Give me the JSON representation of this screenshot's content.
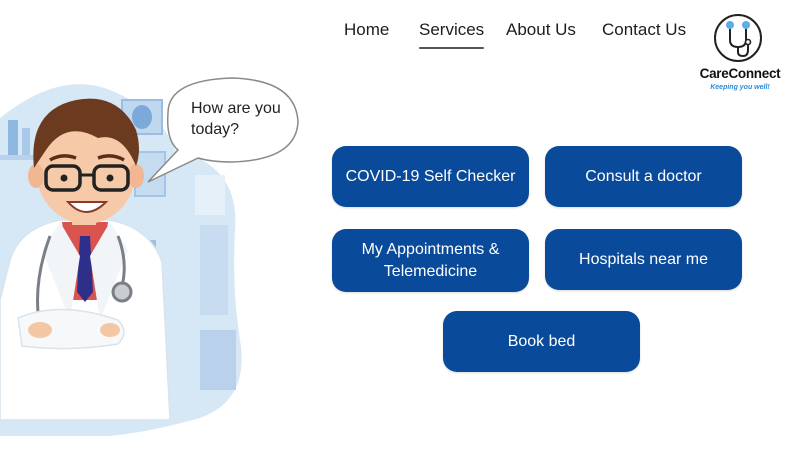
{
  "nav": {
    "items": [
      {
        "label": "Home",
        "active": false
      },
      {
        "label": "Services",
        "active": true
      },
      {
        "label": "About Us",
        "active": false
      },
      {
        "label": "Contact Us",
        "active": false
      }
    ]
  },
  "logo": {
    "name": "CareConnect",
    "tagline": "Keeping you well!",
    "icon": "stethoscope-icon",
    "tagline_color": "#2a8bd8"
  },
  "bubble": {
    "text_line1": "How are you",
    "text_line2": "today?"
  },
  "services": {
    "covid_checker": "COVID-19 Self Checker",
    "consult_doctor": "Consult a doctor",
    "appointments_line1": "My Appointments &",
    "appointments_line2": "Telemedicine",
    "hospitals": "Hospitals near me",
    "book_bed": "Book bed"
  },
  "colors": {
    "button_bg": "#0a4a9a",
    "button_text": "#ffffff",
    "illustration_bg": "#d3e5f5"
  }
}
